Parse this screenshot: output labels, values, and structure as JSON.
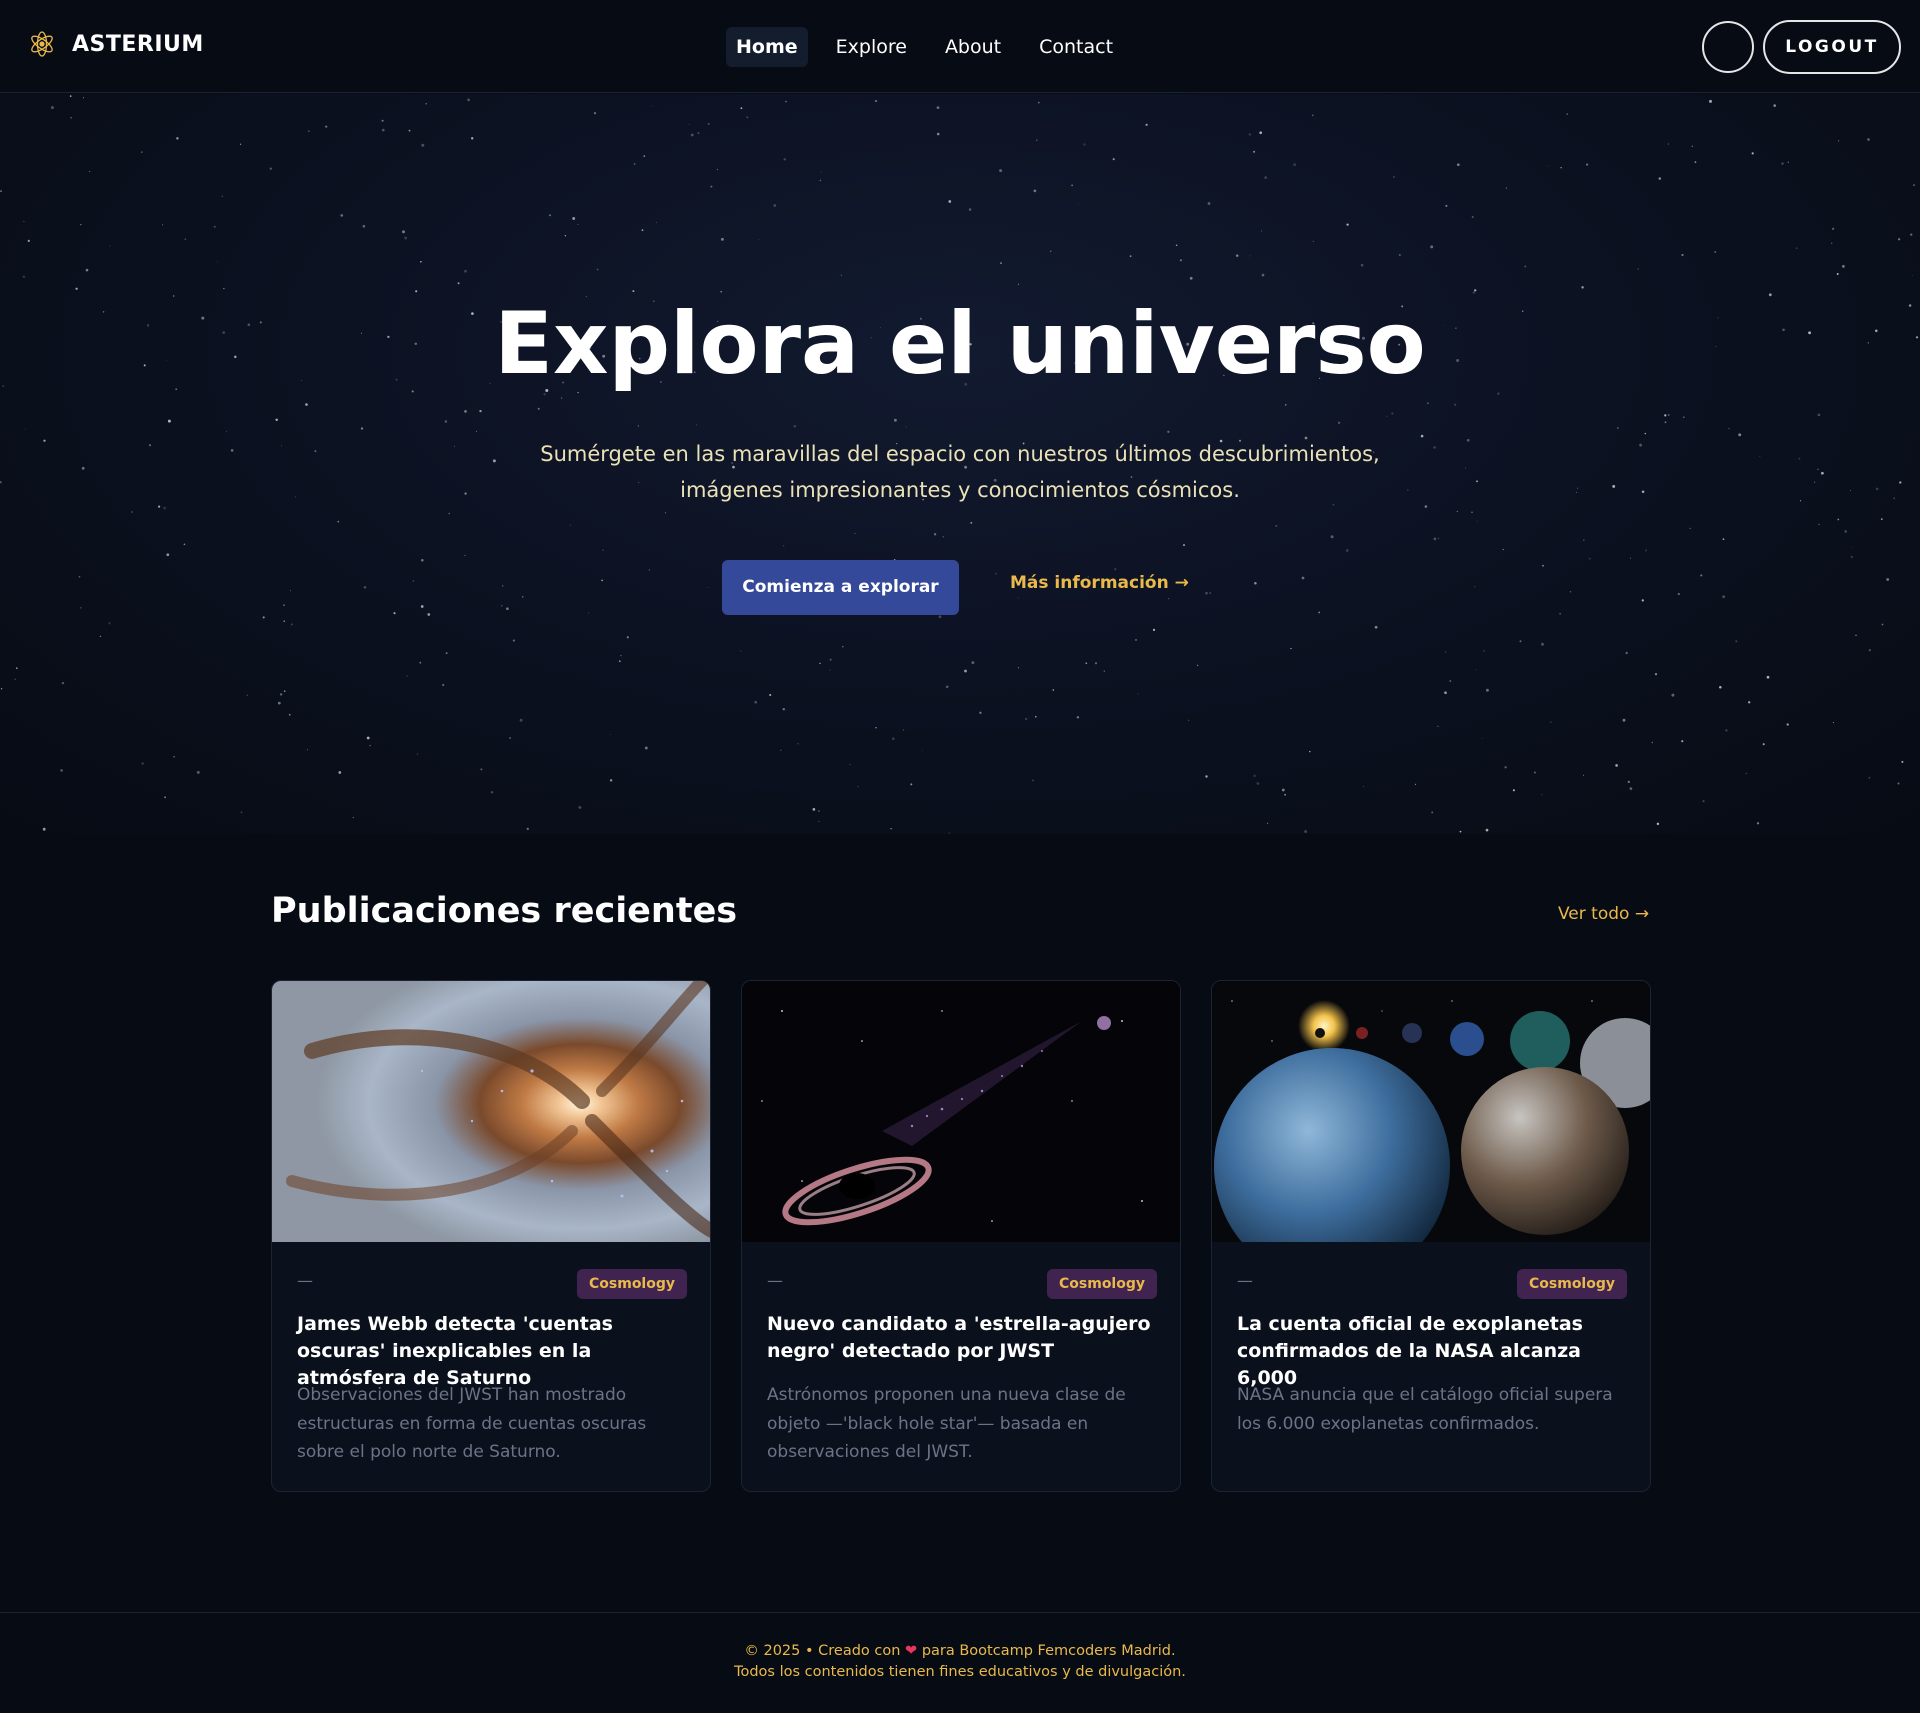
{
  "brand": {
    "name": "ASTERIUM",
    "logo_icon": "atom-star-icon"
  },
  "nav": {
    "items": [
      {
        "label": "Home",
        "active": true
      },
      {
        "label": "Explore",
        "active": false
      },
      {
        "label": "About",
        "active": false
      },
      {
        "label": "Contact",
        "active": false
      }
    ],
    "logout_label": "LOGOUT"
  },
  "hero": {
    "title": "Explora el universo",
    "subtitle": "Sumérgete en las maravillas del espacio con nuestros últimos descubrimientos, imágenes impresionantes y conocimientos cósmicos.",
    "primary_cta": "Comienza a explorar",
    "secondary_cta": "Más información →"
  },
  "posts": {
    "section_title": "Publicaciones recientes",
    "see_all": "Ver todo →",
    "items": [
      {
        "image": "spiral-galaxy",
        "date": "—",
        "category": "Cosmology",
        "title": "James Webb detecta 'cuentas oscuras' inexplicables en la atmósfera de Saturno",
        "excerpt": "Observaciones del JWST han mostrado estructuras en forma de cuentas oscuras sobre el polo norte de Saturno."
      },
      {
        "image": "black-hole-star",
        "date": "—",
        "category": "Cosmology",
        "title": "Nuevo candidato a 'estrella-agujero negro' detectado por JWST",
        "excerpt": "Astrónomos proponen una nueva clase de objeto —'black hole star'— basada en observaciones del JWST."
      },
      {
        "image": "exoplanets",
        "date": "—",
        "category": "Cosmology",
        "title": "La cuenta oficial de exoplanetas confirmados de la NASA alcanza 6,000",
        "excerpt": "NASA anuncia que el catálogo oficial supera los 6.000 exoplanetas confirmados."
      }
    ]
  },
  "footer": {
    "line1_prefix": "© 2025 • Creado con",
    "line1_suffix": "para Bootcamp Femcoders Madrid.",
    "line2": "Todos los contenidos tienen fines educativos y de divulgación."
  },
  "colors": {
    "background": "#070b14",
    "accent": "#e9b94b",
    "primary_button": "#34499a",
    "badge_bg": "#41234f",
    "heart": "#e8365f"
  }
}
